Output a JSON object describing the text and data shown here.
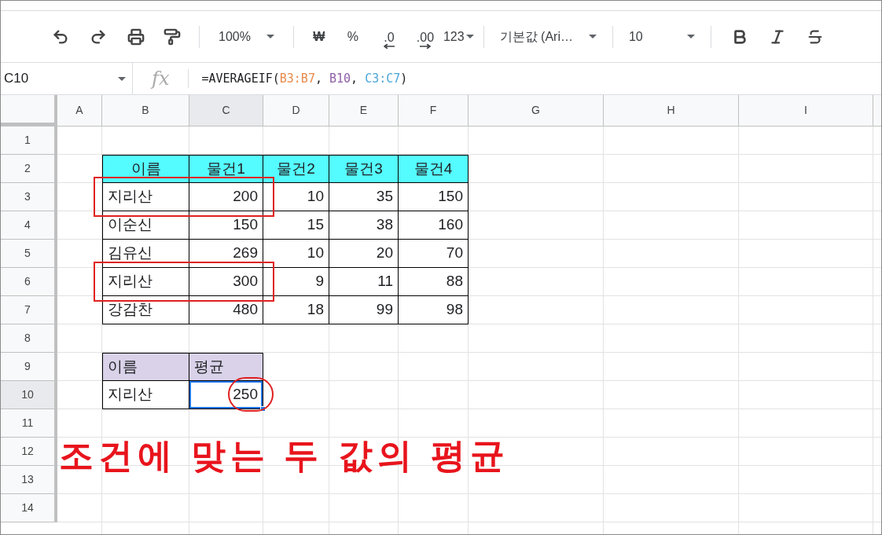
{
  "toolbar": {
    "zoom": "100%",
    "currency": "₩",
    "percent": "%",
    "decrease_decimal": ".0",
    "increase_decimal": ".00",
    "number_format": "123",
    "font": "기본값 (Ari…",
    "font_size": "10"
  },
  "formula_bar": {
    "cell_ref": "C10",
    "fx_label": "fx",
    "formula": [
      {
        "text": "=AVERAGEIF("
      },
      {
        "text": "B3:B7",
        "color": "#e8894a"
      },
      {
        "text": ", "
      },
      {
        "text": "B10",
        "color": "#8e5ea8"
      },
      {
        "text": ", "
      },
      {
        "text": "C3:C7",
        "color": "#4aa6d8"
      },
      {
        "text": ")"
      }
    ]
  },
  "columns": [
    {
      "label": "A",
      "selected": false
    },
    {
      "label": "B",
      "selected": false
    },
    {
      "label": "C",
      "selected": true
    },
    {
      "label": "D",
      "selected": false
    },
    {
      "label": "E",
      "selected": false
    },
    {
      "label": "F",
      "selected": false
    },
    {
      "label": "G",
      "selected": false
    },
    {
      "label": "H",
      "selected": false
    },
    {
      "label": "I",
      "selected": false
    }
  ],
  "rows": [
    {
      "label": "1",
      "selected": false
    },
    {
      "label": "2",
      "selected": false
    },
    {
      "label": "3",
      "selected": false
    },
    {
      "label": "4",
      "selected": false
    },
    {
      "label": "5",
      "selected": false
    },
    {
      "label": "6",
      "selected": false
    },
    {
      "label": "7",
      "selected": false
    },
    {
      "label": "8",
      "selected": false
    },
    {
      "label": "9",
      "selected": false
    },
    {
      "label": "10",
      "selected": true
    },
    {
      "label": "11",
      "selected": false
    },
    {
      "label": "12",
      "selected": false
    },
    {
      "label": "13",
      "selected": false
    },
    {
      "label": "14",
      "selected": false
    }
  ],
  "data_table": {
    "header": [
      "이름",
      "물건1",
      "물건2",
      "물건3",
      "물건4"
    ],
    "rows": [
      {
        "cells": [
          "지리산",
          "200",
          "10",
          "35",
          "150"
        ],
        "highlighted": true
      },
      {
        "cells": [
          "이순신",
          "150",
          "15",
          "38",
          "160"
        ],
        "highlighted": false
      },
      {
        "cells": [
          "김유신",
          "269",
          "10",
          "20",
          "70"
        ],
        "highlighted": false
      },
      {
        "cells": [
          "지리산",
          "300",
          "9",
          "11",
          "88"
        ],
        "highlighted": true
      },
      {
        "cells": [
          "강감찬",
          "480",
          "18",
          "99",
          "98"
        ],
        "highlighted": false
      }
    ]
  },
  "summary_table": {
    "header": [
      "이름",
      "평균"
    ],
    "rows": [
      {
        "cells": [
          {
            "text": "지리산",
            "selected": false,
            "circled": false
          },
          {
            "text": "250",
            "selected": true,
            "circled": true
          }
        ]
      }
    ]
  },
  "annotation": "조건에 맞는 두 값의 평균"
}
